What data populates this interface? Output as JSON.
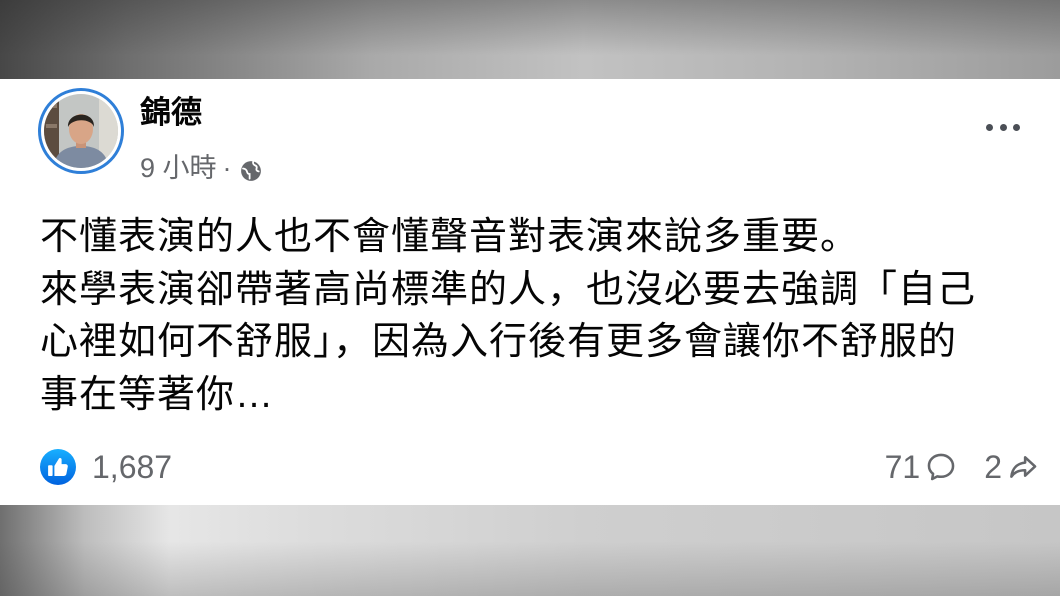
{
  "post": {
    "author": "錦德",
    "timestamp": "9 小時",
    "separator": "·",
    "privacy_icon": "globe-icon",
    "menu_icon": "more-horizontal-icon",
    "body_lines": [
      "不懂表演的人也不會懂聲音對表演來說多重要。",
      "來學表演卻帶著高尚標準的人，也沒必要去強調「自己",
      "心裡如何不舒服」，因為入行後有更多會讓你不舒服的",
      "事在等著你…"
    ],
    "reactions": {
      "icon": "like-icon",
      "count": "1,687"
    },
    "comments": {
      "icon": "comment-icon",
      "count": "71"
    },
    "shares": {
      "icon": "share-icon",
      "count": "2"
    }
  },
  "colors": {
    "accent": "#1877F2",
    "text_primary": "#050505",
    "text_secondary": "#65676B",
    "card_background": "#FFFFFF"
  }
}
